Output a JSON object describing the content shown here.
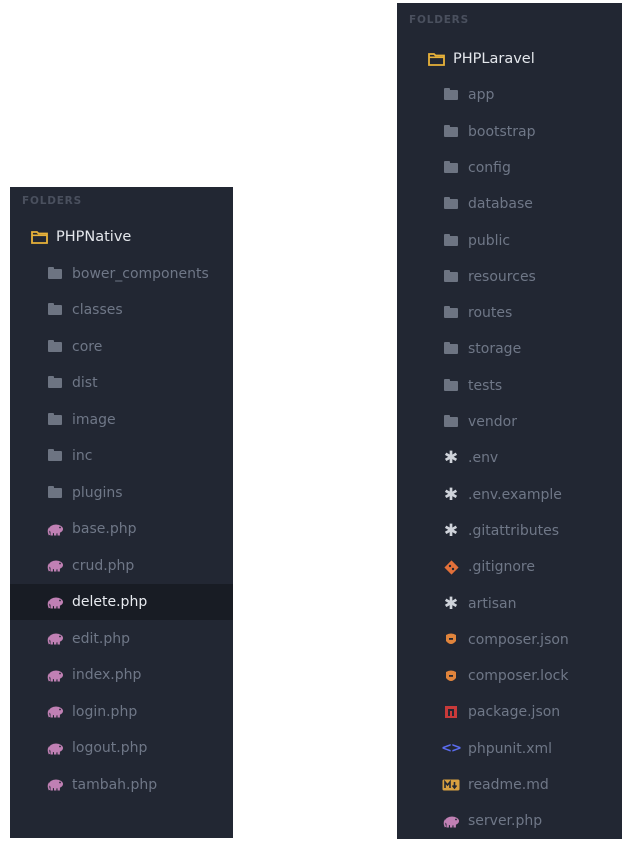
{
  "left_panel": {
    "header": "FOLDERS",
    "root": {
      "label": "PHPNative",
      "icon": "folder-open-icon"
    },
    "items": [
      {
        "label": "bower_components",
        "icon": "folder-icon",
        "type": "folder"
      },
      {
        "label": "classes",
        "icon": "folder-icon",
        "type": "folder"
      },
      {
        "label": "core",
        "icon": "folder-icon",
        "type": "folder"
      },
      {
        "label": "dist",
        "icon": "folder-icon",
        "type": "folder"
      },
      {
        "label": "image",
        "icon": "folder-icon",
        "type": "folder"
      },
      {
        "label": "inc",
        "icon": "folder-icon",
        "type": "folder"
      },
      {
        "label": "plugins",
        "icon": "folder-icon",
        "type": "folder"
      },
      {
        "label": "base.php",
        "icon": "php-elephant-icon",
        "type": "file"
      },
      {
        "label": "crud.php",
        "icon": "php-elephant-icon",
        "type": "file"
      },
      {
        "label": "delete.php",
        "icon": "php-elephant-icon",
        "type": "file",
        "selected": true
      },
      {
        "label": "edit.php",
        "icon": "php-elephant-icon",
        "type": "file"
      },
      {
        "label": "index.php",
        "icon": "php-elephant-icon",
        "type": "file"
      },
      {
        "label": "login.php",
        "icon": "php-elephant-icon",
        "type": "file"
      },
      {
        "label": "logout.php",
        "icon": "php-elephant-icon",
        "type": "file"
      },
      {
        "label": "tambah.php",
        "icon": "php-elephant-icon",
        "type": "file"
      }
    ]
  },
  "right_panel": {
    "header": "FOLDERS",
    "root": {
      "label": "PHPLaravel",
      "icon": "folder-open-icon"
    },
    "items": [
      {
        "label": "app",
        "icon": "folder-icon",
        "type": "folder"
      },
      {
        "label": "bootstrap",
        "icon": "folder-icon",
        "type": "folder"
      },
      {
        "label": "config",
        "icon": "folder-icon",
        "type": "folder"
      },
      {
        "label": "database",
        "icon": "folder-icon",
        "type": "folder"
      },
      {
        "label": "public",
        "icon": "folder-icon",
        "type": "folder"
      },
      {
        "label": "resources",
        "icon": "folder-icon",
        "type": "folder"
      },
      {
        "label": "routes",
        "icon": "folder-icon",
        "type": "folder"
      },
      {
        "label": "storage",
        "icon": "folder-icon",
        "type": "folder"
      },
      {
        "label": "tests",
        "icon": "folder-icon",
        "type": "folder"
      },
      {
        "label": "vendor",
        "icon": "folder-icon",
        "type": "folder"
      },
      {
        "label": ".env",
        "icon": "asterisk-icon",
        "type": "file"
      },
      {
        "label": ".env.example",
        "icon": "asterisk-icon",
        "type": "file"
      },
      {
        "label": ".gitattributes",
        "icon": "asterisk-icon",
        "type": "file"
      },
      {
        "label": ".gitignore",
        "icon": "git-icon",
        "type": "file"
      },
      {
        "label": "artisan",
        "icon": "asterisk-icon",
        "type": "file"
      },
      {
        "label": "composer.json",
        "icon": "composer-icon",
        "type": "file"
      },
      {
        "label": "composer.lock",
        "icon": "composer-icon",
        "type": "file"
      },
      {
        "label": "package.json",
        "icon": "npm-icon",
        "type": "file"
      },
      {
        "label": "phpunit.xml",
        "icon": "code-brackets-icon",
        "type": "file"
      },
      {
        "label": "readme.md",
        "icon": "markdown-icon",
        "type": "file"
      },
      {
        "label": "server.php",
        "icon": "php-elephant-icon",
        "type": "file"
      }
    ]
  },
  "colors": {
    "panel_bg": "#222733",
    "selected_bg": "#181c24",
    "root_text": "#e4e7ec",
    "item_text": "#6f7787",
    "header_text": "#4a505e",
    "folder_icon": "#6d7482",
    "folder_open_icon": "#e8b23a",
    "php_icon": "#c080b4",
    "git_icon": "#e2703a",
    "composer_icon": "#e0843c",
    "npm_icon": "#c83a3a",
    "xml_icon": "#5b6cf0",
    "markdown_icon": "#d8a040"
  }
}
